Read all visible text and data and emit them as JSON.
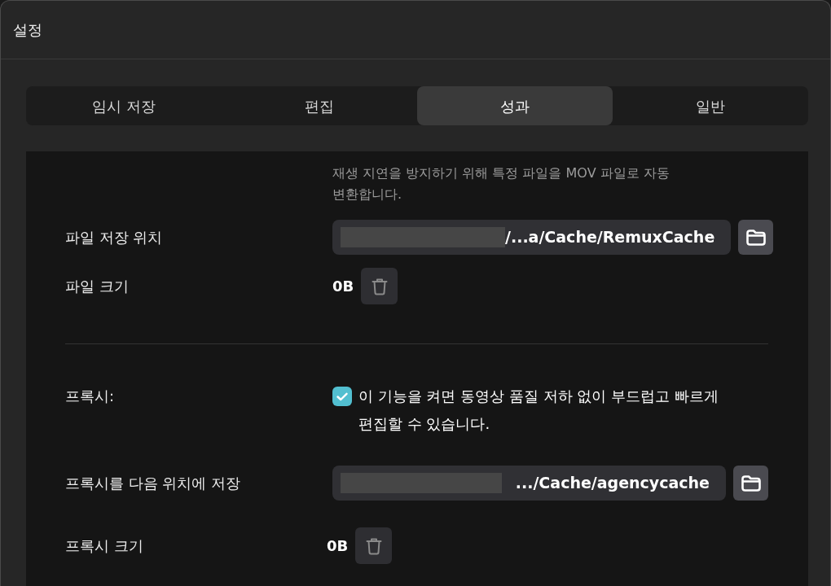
{
  "window": {
    "title": "설정"
  },
  "tabs": [
    {
      "label": "임시 저장",
      "selected": false
    },
    {
      "label": "편집",
      "selected": false
    },
    {
      "label": "성과",
      "selected": true
    },
    {
      "label": "일반",
      "selected": false
    }
  ],
  "remux": {
    "description": "재생 지연을 방지하기 위해 특정 파일을 MOV 파일로 자동 변환합니다.",
    "location": {
      "label": "파일 저장 위치",
      "value": "/...a/Cache/RemuxCache"
    },
    "size": {
      "label": "파일 크기",
      "value": "0B"
    }
  },
  "proxy": {
    "label": "프록시:",
    "checkbox": {
      "checked": true,
      "text": "이 기능을 켜면 동영상 품질 저하 없이 부드럽고 빠르게 편집할 수 있습니다."
    },
    "location": {
      "label": "프록시를 다음 위치에 저장",
      "value": ".../Cache/agencycache"
    },
    "size": {
      "label": "프록시 크기",
      "value": "0B"
    }
  }
}
